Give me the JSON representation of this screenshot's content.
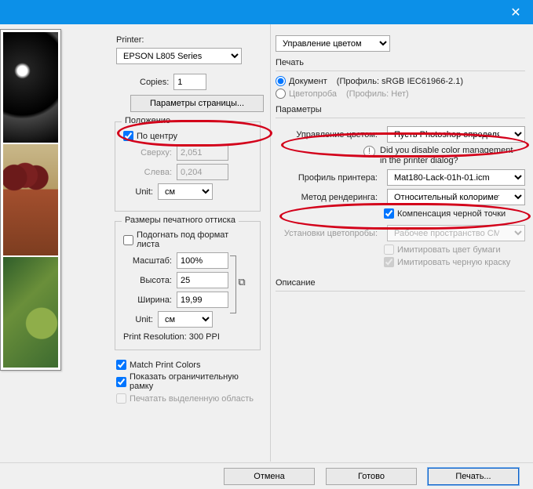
{
  "titlebar": {
    "close_glyph": "✕"
  },
  "left": {
    "printer_label": "Printer:",
    "printer_value": "EPSON L805 Series",
    "copies_label": "Copies:",
    "copies_value": "1",
    "page_setup_btn": "Параметры страницы...",
    "position_legend": "Положение",
    "center_label": "По центру",
    "top_label": "Сверху:",
    "top_value": "2,051",
    "left_label": "Слева:",
    "left_value": "0,204",
    "unit_label": "Unit:",
    "unit_value": "см",
    "scaled_legend": "Размеры печатного оттиска",
    "fit_media_label": "Подогнать под формат листа",
    "scale_label": "Масштаб:",
    "scale_value": "100%",
    "height_label": "Высота:",
    "height_value": "25",
    "width_label": "Ширина:",
    "width_value": "19,99",
    "resolution_text": "Print Resolution: 300 PPI",
    "match_colors_label": "Match Print Colors",
    "show_bbox_label": "Показать ограничительную рамку",
    "print_sel_label": "Печатать выделенную область"
  },
  "right": {
    "top_select": "Управление цветом",
    "print_heading": "Печать",
    "doc_label": "Документ",
    "doc_profile": "(Профиль: sRGB IEC61966-2.1)",
    "proof_label": "Цветопроба",
    "proof_profile": "(Профиль: Нет)",
    "params_heading": "Параметры",
    "color_handling_label": "Управление цветом:",
    "color_handling_value": "Пусть Photoshop определяет ...",
    "warn_text1": "Did you disable color management",
    "warn_text2": "in the printer dialog?",
    "printer_profile_label": "Профиль принтера:",
    "printer_profile_value": "Mat180-Lack-01h-01.icm",
    "rendering_label": "Метод рендеринга:",
    "rendering_value": "Относительный колориметр...",
    "bpc_label": "Компенсация черной точки",
    "proof_setup_label": "Установки цветопробы:",
    "proof_setup_value": "Рабочее пространство CMYK",
    "sim_paper_label": "Имитировать цвет бумаги",
    "sim_black_label": "Имитировать черную краску",
    "description_heading": "Описание"
  },
  "footer": {
    "cancel": "Отмена",
    "done": "Готово",
    "print": "Печать..."
  }
}
